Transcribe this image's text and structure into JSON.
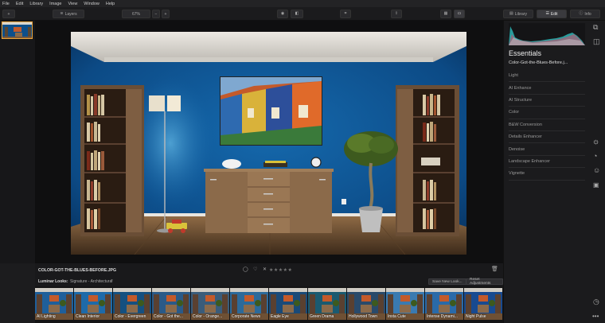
{
  "menu": [
    "File",
    "Edit",
    "Library",
    "Image",
    "View",
    "Window",
    "Help"
  ],
  "toolbar": {
    "add_label": "+",
    "layers_label": "Layers",
    "zoom_value": "67%",
    "zoom_minus": "−",
    "zoom_plus": "+",
    "library_label": "Library",
    "edit_label": "Edit",
    "info_label": "Info"
  },
  "panel": {
    "title": "Essentials",
    "filename": "Color-Got-the-Blues-Before.j...",
    "tools": [
      "Light",
      "AI Enhance",
      "AI Structure",
      "Color",
      "B&W Conversion",
      "Details Enhancer",
      "Denoise",
      "Landscape Enhancer",
      "Vignette"
    ]
  },
  "infobar": {
    "filename": "COLOR-GOT-THE-BLUES-BEFORE.JPG",
    "rating_stars": "★★★★★"
  },
  "looksbar": {
    "label": "Luminar Looks:",
    "category": "Signature - Architectural",
    "save_new_look": "Save New Look...",
    "reset_adjustments": "Reset Adjustments"
  },
  "looks": [
    "AI Lighting",
    "Clean Interior",
    "Color - Evergreen",
    "Color - Got the...",
    "Color - Orange...",
    "Corporate News",
    "Eagle Eye",
    "Green Drama",
    "Hollywood Town",
    "Insta Cute",
    "Intense Dynami...",
    "Night Pulse"
  ],
  "colors": {
    "accent": "#e8a33a",
    "wall": "#0e4f8a",
    "ceiling": "#d9d6d0",
    "floor": "#7a5a3c"
  }
}
